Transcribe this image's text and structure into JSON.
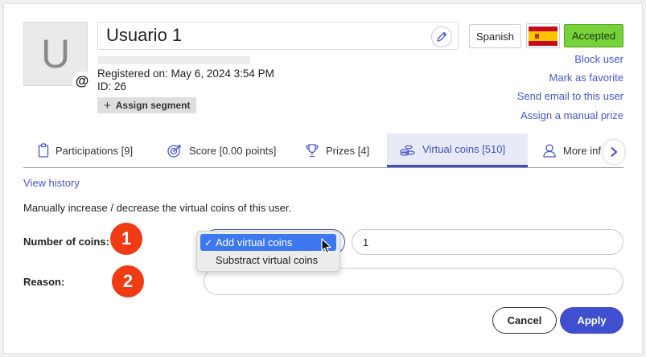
{
  "user": {
    "avatar_letter": "U",
    "name": "Usuario 1",
    "registered": "Registered on: May 6, 2024 3:54 PM",
    "id_text": "ID: 26",
    "assign_segment": "Assign segment"
  },
  "header": {
    "language": "Spanish",
    "status": "Accepted",
    "status_color": "#76d13a"
  },
  "actions": {
    "block": "Block user",
    "favorite": "Mark as favorite",
    "email": "Send email to this user",
    "prize": "Assign a manual prize"
  },
  "tabs": [
    {
      "label": "Participations [9]",
      "icon": "clipboard-icon"
    },
    {
      "label": "Score [0.00 points]",
      "icon": "target-icon"
    },
    {
      "label": "Prizes [4]",
      "icon": "trophy-icon"
    },
    {
      "label": "Virtual coins [510]",
      "icon": "coins-icon",
      "active": true
    },
    {
      "label": "More inf",
      "icon": "user-icon"
    }
  ],
  "content": {
    "view_history": "View history",
    "description": "Manually increase / decrease the virtual coins of this user.",
    "coins_label": "Number of coins:",
    "reason_label": "Reason:",
    "coins_value": "1",
    "step1": "1",
    "step2": "2"
  },
  "dropdown": {
    "options": [
      "Add virtual coins",
      "Substract virtual coins"
    ],
    "selected": "Add virtual coins"
  },
  "buttons": {
    "cancel": "Cancel",
    "apply": "Apply"
  },
  "colors": {
    "accent": "#3f4fd0",
    "link": "#4756c9",
    "step_badge": "#f03b14"
  }
}
